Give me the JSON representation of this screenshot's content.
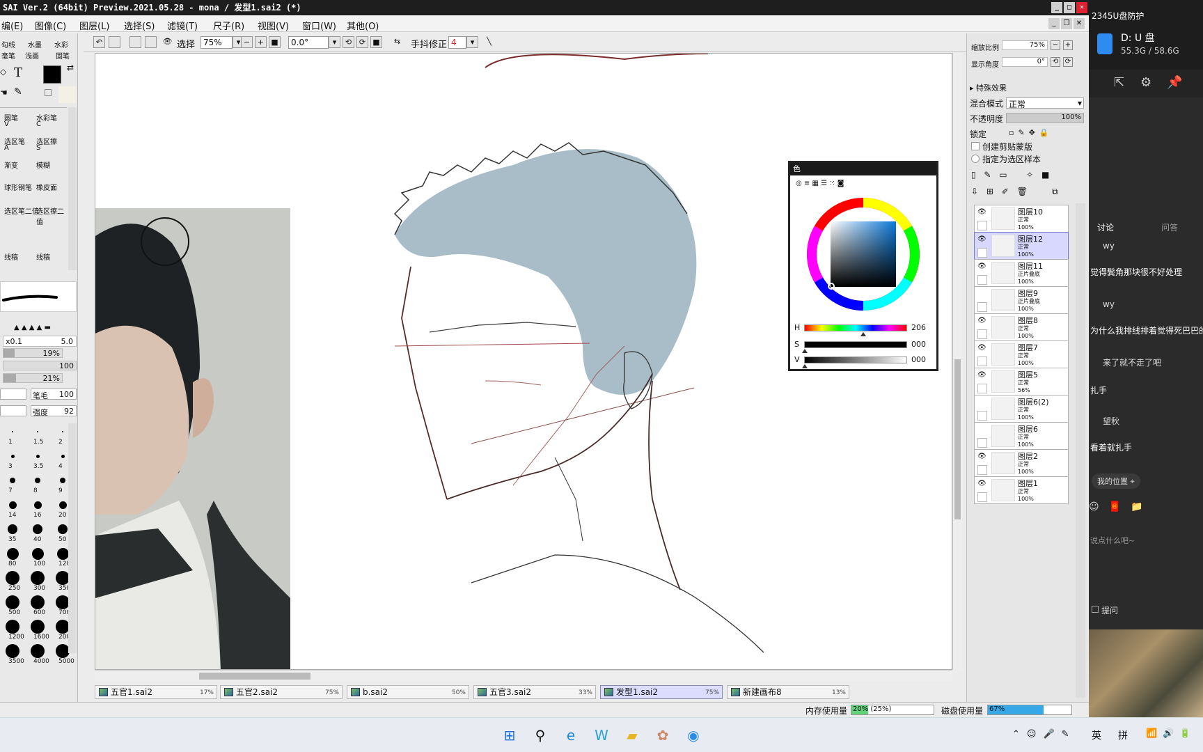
{
  "titlebar": {
    "title": "SAI Ver.2 (64bit) Preview.2021.05.28 - mona / 发型1.sai2 (*)"
  },
  "menubar": {
    "items": [
      "编(E)",
      "图像(C)",
      "图层(L)",
      "选择(S)",
      "滤镜(T)",
      "尺子(R)",
      "视图(V)",
      "窗口(W)",
      "其他(O)"
    ]
  },
  "toolbar": {
    "select_label": "选择",
    "zoom": "75%",
    "angle": "0.0°",
    "stabilizer_label": "手抖修正",
    "stabilizer_value": "4"
  },
  "lefttools": {
    "top_labels": [
      "勾线",
      "水墨",
      "水彩",
      "毫笔",
      "浅画",
      "固笔"
    ],
    "brushes": [
      "圆笔",
      "水彩笔",
      "选区笔",
      "选区擦",
      "渐变",
      "模糊",
      "球形钢笔",
      "橡皮面",
      "选区笔二值",
      "选区擦二值",
      "线稿",
      "线稿"
    ],
    "brush_shortcuts": [
      "V",
      "C",
      "A",
      "S"
    ],
    "size_label": "x0.1",
    "size_value": "5.0",
    "percent1": "19%",
    "value100": "100",
    "percent2": "21%",
    "param1_label": "笔毛",
    "param1_value": "100",
    "param2_label": "强度",
    "param2_value": "92",
    "dot_labels": [
      "1",
      "1.5",
      "2",
      "3",
      "3.5",
      "4",
      "7",
      "8",
      "9",
      "14",
      "16",
      "20",
      "35",
      "40",
      "50",
      "80",
      "100",
      "120",
      "250",
      "300",
      "350",
      "500",
      "600",
      "700",
      "1200",
      "1600",
      "2000",
      "3500",
      "4000",
      "5000"
    ]
  },
  "rightpanel": {
    "zoom_label": "缩放比例",
    "zoom_value": "75%",
    "angle_label": "显示角度",
    "angle_value": "0°",
    "effects_label": "特殊效果",
    "blend_label": "混合模式",
    "blend_value": "正常",
    "opacity_label": "不透明度",
    "opacity_value": "100%",
    "lock_label": "锁定",
    "clip_label": "创建剪贴蒙版",
    "sample_label": "指定为选区样本",
    "layers": [
      {
        "name": "图层10",
        "mode": "正常",
        "opacity": "100%",
        "visible": true,
        "selected": false
      },
      {
        "name": "图层12",
        "mode": "正常",
        "opacity": "100%",
        "visible": true,
        "selected": true
      },
      {
        "name": "图层11",
        "mode": "正片叠底",
        "opacity": "100%",
        "visible": true,
        "selected": false
      },
      {
        "name": "图层9",
        "mode": "正片叠底",
        "opacity": "100%",
        "visible": false,
        "selected": false
      },
      {
        "name": "图层8",
        "mode": "正常",
        "opacity": "100%",
        "visible": true,
        "selected": false
      },
      {
        "name": "图层7",
        "mode": "正常",
        "opacity": "100%",
        "visible": true,
        "selected": false
      },
      {
        "name": "图层5",
        "mode": "正常",
        "opacity": "56%",
        "visible": true,
        "selected": false
      },
      {
        "name": "图层6(2)",
        "mode": "正常",
        "opacity": "100%",
        "visible": false,
        "selected": false
      },
      {
        "name": "图层6",
        "mode": "正常",
        "opacity": "100%",
        "visible": false,
        "selected": false
      },
      {
        "name": "图层2",
        "mode": "正常",
        "opacity": "100%",
        "visible": true,
        "selected": false
      },
      {
        "name": "图层1",
        "mode": "正常",
        "opacity": "100%",
        "visible": true,
        "selected": false
      }
    ]
  },
  "colorwin": {
    "title": "色",
    "h_label": "H",
    "h_value": "206",
    "s_label": "S",
    "s_value": "000",
    "v_label": "V",
    "v_value": "000",
    "h_level": 0.57,
    "s_level": 0,
    "v_level": 0
  },
  "tabs": [
    {
      "name": "五官1.sai2",
      "zoom": "17%"
    },
    {
      "name": "五官2.sai2",
      "zoom": "75%"
    },
    {
      "name": "b.sai2",
      "zoom": "50%"
    },
    {
      "name": "五官3.sai2",
      "zoom": "33%"
    },
    {
      "name": "发型1.sai2",
      "zoom": "75%"
    },
    {
      "name": "新建画布8",
      "zoom": "13%"
    }
  ],
  "statusbar": {
    "mem_label": "内存使用量",
    "mem_value": "20% (25%)",
    "disk_label": "磁盘使用量",
    "disk_value": "67%",
    "mem_level": 0.2,
    "disk_level": 0.67
  },
  "sideapp": {
    "title": "2345U盘防护",
    "drive_name": "D: U 盘",
    "drive_size": "55.3G / 58.6G",
    "tab_discuss": "讨论",
    "tab_qa": "问答",
    "messages": [
      {
        "user": "wy",
        "text": "觉得鬓角那块很不好处理"
      },
      {
        "user": "wy",
        "text": "为什么我排线排着觉得死巴巴的"
      },
      {
        "user": "来了就不走了吧",
        "text": "扎手"
      },
      {
        "user": "望秋",
        "text": "看着就扎手"
      }
    ],
    "location": "我的位置",
    "input_placeholder": "说点什么吧~",
    "ask_label": "提问"
  },
  "taskbar": {
    "ime_en": "英",
    "ime_pin": "拼"
  }
}
